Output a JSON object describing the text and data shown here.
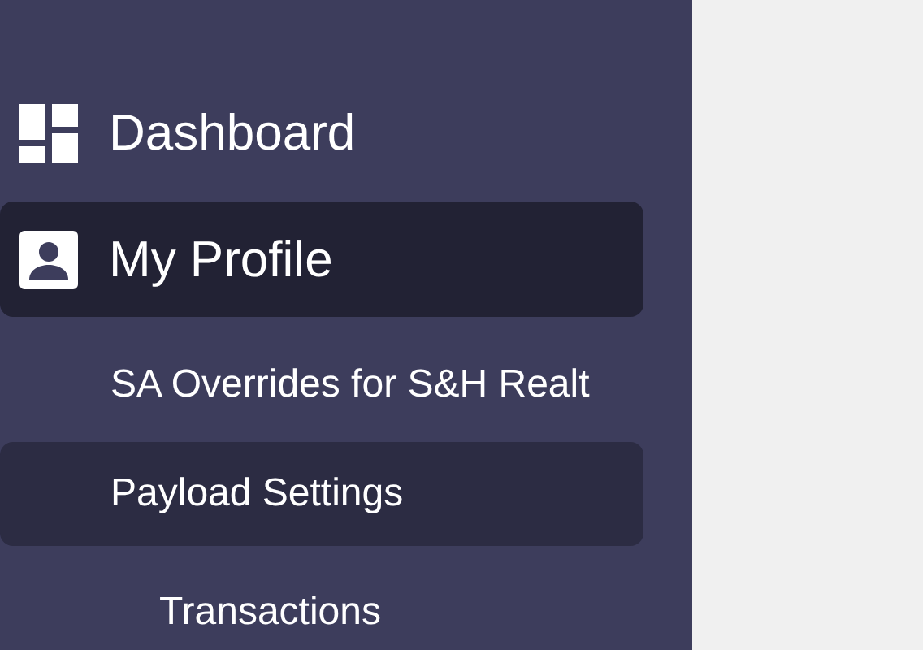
{
  "sidebar": {
    "items": [
      {
        "label": "Dashboard",
        "selected": false
      },
      {
        "label": "My Profile",
        "selected": true,
        "children": [
          {
            "label": "SA Overrides for S&H Realt",
            "selected": false
          },
          {
            "label": "Payload Settings",
            "selected": true,
            "children": [
              {
                "label": "Transactions",
                "selected": false
              }
            ]
          }
        ]
      }
    ]
  }
}
